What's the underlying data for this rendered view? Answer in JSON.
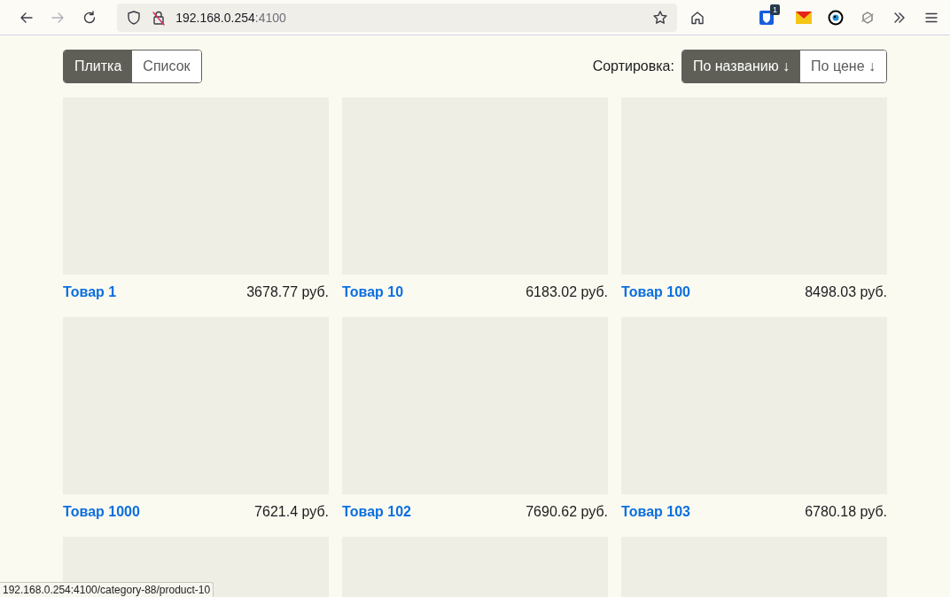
{
  "browser": {
    "url_host": "192.168.0.254",
    "url_port": ":4100",
    "forward_disabled": true,
    "extension_badge": "1"
  },
  "view_toggle": [
    {
      "label": "Плитка",
      "selected": true
    },
    {
      "label": "Список",
      "selected": false
    }
  ],
  "sort": {
    "label": "Сортировка:",
    "options": [
      {
        "label": "По названию ↓",
        "selected": true
      },
      {
        "label": "По цене ↓",
        "selected": false
      }
    ]
  },
  "products": [
    {
      "name": "Товар 1",
      "price": "3678.77 руб."
    },
    {
      "name": "Товар 10",
      "price": "6183.02 руб."
    },
    {
      "name": "Товар 100",
      "price": "8498.03 руб."
    },
    {
      "name": "Товар 1000",
      "price": "7621.4 руб."
    },
    {
      "name": "Товар 102",
      "price": "7690.62 руб."
    },
    {
      "name": "Товар 103",
      "price": "6780.18 руб."
    }
  ],
  "partial_row": [
    {
      "kind": "image"
    },
    {
      "kind": "image"
    },
    {
      "kind": "image"
    }
  ],
  "status_bar": "192.168.0.254:4100/category-88/product-10"
}
